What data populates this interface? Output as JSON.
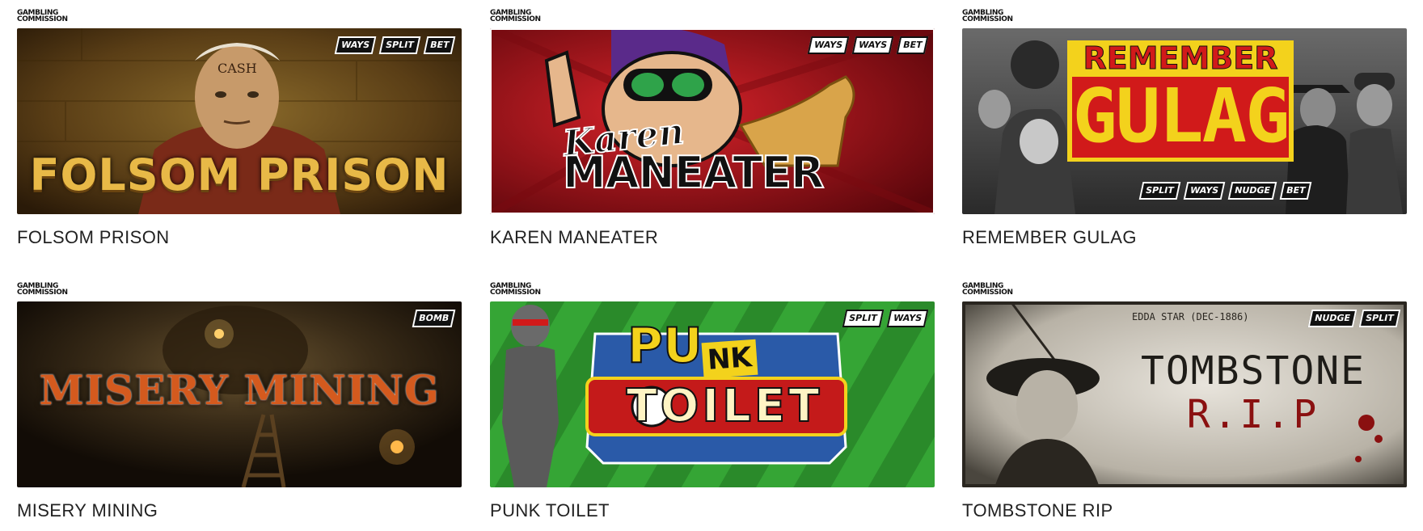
{
  "games": [
    {
      "title": "FOLSOM PRISON",
      "image_title": "FOLSOM PRISON",
      "regulator": "GAMBLING\nCOMMISSION",
      "features": [
        "WAYS",
        "SPLIT",
        "BET"
      ],
      "tattoo": "CASH"
    },
    {
      "title": "KAREN MANEATER",
      "image_title_line1": "Karen",
      "image_title_line2": "MANEATER",
      "regulator": "GAMBLING\nCOMMISSION",
      "features": [
        "WAYS",
        "WAYS",
        "BET"
      ]
    },
    {
      "title": "REMEMBER GULAG",
      "image_title_line1": "REMEMBER",
      "image_title_line2": "GULAG",
      "regulator": "GAMBLING\nCOMMISSION",
      "features": [
        "SPLIT",
        "WAYS",
        "NUDGE",
        "BET"
      ]
    },
    {
      "title": "MISERY MINING",
      "image_title": "MISERY MINING",
      "regulator": "GAMBLING\nCOMMISSION",
      "features": [
        "BOMB"
      ]
    },
    {
      "title": "PUNK TOILET",
      "image_title_line1a": "PU",
      "image_title_line1b": "NK",
      "image_title_line2": "TOILET",
      "regulator": "GAMBLING\nCOMMISSION",
      "features": [
        "SPLIT",
        "WAYS"
      ]
    },
    {
      "title": "TOMBSTONE RIP",
      "image_title_line1": "TOMBSTONE",
      "image_title_line2": "R.I.P",
      "image_subtitle": "EDDA STAR (DEC-1886)",
      "regulator": "GAMBLING\nCOMMISSION",
      "features": [
        "NUDGE",
        "SPLIT"
      ]
    }
  ],
  "colors": {
    "caption": "#222222",
    "folsom_gold": "#d9a93a",
    "karen_red": "#b3121b",
    "gulag_red": "#d11a1a",
    "gulag_yellow": "#f3d21c",
    "punk_green": "#2f9e2f",
    "mining_orange": "#d45a1e"
  }
}
